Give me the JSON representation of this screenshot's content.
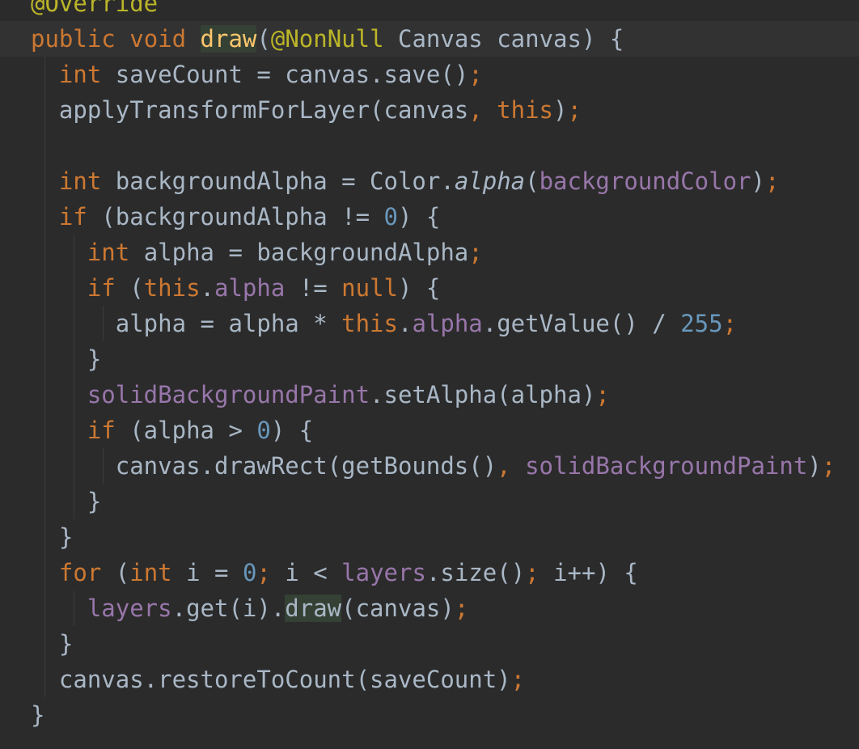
{
  "editor": {
    "colors": {
      "background": "#2b2b2b",
      "current_line": "#323232",
      "default_text": "#a9b7c6",
      "keyword": "#cc7832",
      "annotation": "#bbb529",
      "method_declaration": "#ffc66d",
      "field": "#9876aa",
      "number": "#6897bb",
      "usage_highlight": "#344134",
      "indent_guide": "#3b3b3b"
    },
    "lines": [
      {
        "indent": 0,
        "tokens": [
          {
            "t": "@Override",
            "c": "ann"
          }
        ]
      },
      {
        "indent": 0,
        "current": true,
        "tokens": [
          {
            "t": "public",
            "c": "kw"
          },
          {
            "t": " "
          },
          {
            "t": "void",
            "c": "kw"
          },
          {
            "t": " "
          },
          {
            "t": "draw",
            "c": "fn",
            "hl": true
          },
          {
            "t": "("
          },
          {
            "t": "@NonNull",
            "c": "ann"
          },
          {
            "t": " Canvas canvas) {"
          }
        ]
      },
      {
        "indent": 1,
        "tokens": [
          {
            "t": "int",
            "c": "kw"
          },
          {
            "t": " saveCount = canvas.save()"
          },
          {
            "t": ";",
            "c": "kw"
          }
        ]
      },
      {
        "indent": 1,
        "tokens": [
          {
            "t": "applyTransformForLayer(canvas"
          },
          {
            "t": ", ",
            "c": "kw"
          },
          {
            "t": "this",
            "c": "kw"
          },
          {
            "t": ")"
          },
          {
            "t": ";",
            "c": "kw"
          }
        ]
      },
      {
        "indent": 1,
        "tokens": []
      },
      {
        "indent": 1,
        "tokens": [
          {
            "t": "int",
            "c": "kw"
          },
          {
            "t": " backgroundAlpha = Color."
          },
          {
            "t": "alpha",
            "it": true
          },
          {
            "t": "("
          },
          {
            "t": "backgroundColor",
            "c": "fld"
          },
          {
            "t": ")"
          },
          {
            "t": ";",
            "c": "kw"
          }
        ]
      },
      {
        "indent": 1,
        "tokens": [
          {
            "t": "if",
            "c": "kw"
          },
          {
            "t": " (backgroundAlpha != "
          },
          {
            "t": "0",
            "c": "num"
          },
          {
            "t": ") {"
          }
        ]
      },
      {
        "indent": 2,
        "tokens": [
          {
            "t": "int",
            "c": "kw"
          },
          {
            "t": " alpha = backgroundAlpha"
          },
          {
            "t": ";",
            "c": "kw"
          }
        ]
      },
      {
        "indent": 2,
        "tokens": [
          {
            "t": "if",
            "c": "kw"
          },
          {
            "t": " ("
          },
          {
            "t": "this",
            "c": "kw"
          },
          {
            "t": "."
          },
          {
            "t": "alpha",
            "c": "fld"
          },
          {
            "t": " != "
          },
          {
            "t": "null",
            "c": "kw"
          },
          {
            "t": ") {"
          }
        ]
      },
      {
        "indent": 3,
        "tokens": [
          {
            "t": "alpha = alpha * "
          },
          {
            "t": "this",
            "c": "kw"
          },
          {
            "t": "."
          },
          {
            "t": "alpha",
            "c": "fld"
          },
          {
            "t": ".getValue() / "
          },
          {
            "t": "255",
            "c": "num"
          },
          {
            "t": ";",
            "c": "kw"
          }
        ]
      },
      {
        "indent": 2,
        "tokens": [
          {
            "t": "}"
          }
        ]
      },
      {
        "indent": 2,
        "tokens": [
          {
            "t": "solidBackgroundPaint",
            "c": "fld"
          },
          {
            "t": ".setAlpha(alpha)"
          },
          {
            "t": ";",
            "c": "kw"
          }
        ]
      },
      {
        "indent": 2,
        "tokens": [
          {
            "t": "if",
            "c": "kw"
          },
          {
            "t": " (alpha > "
          },
          {
            "t": "0",
            "c": "num"
          },
          {
            "t": ") {"
          }
        ]
      },
      {
        "indent": 3,
        "tokens": [
          {
            "t": "canvas.drawRect(getBounds()"
          },
          {
            "t": ", ",
            "c": "kw"
          },
          {
            "t": "solidBackgroundPaint",
            "c": "fld"
          },
          {
            "t": ")"
          },
          {
            "t": ";",
            "c": "kw"
          }
        ]
      },
      {
        "indent": 2,
        "tokens": [
          {
            "t": "}"
          }
        ]
      },
      {
        "indent": 1,
        "tokens": [
          {
            "t": "}"
          }
        ]
      },
      {
        "indent": 1,
        "tokens": [
          {
            "t": "for",
            "c": "kw"
          },
          {
            "t": " ("
          },
          {
            "t": "int",
            "c": "kw"
          },
          {
            "t": " i = "
          },
          {
            "t": "0",
            "c": "num"
          },
          {
            "t": "; ",
            "c": "kw"
          },
          {
            "t": "i < "
          },
          {
            "t": "layers",
            "c": "fld"
          },
          {
            "t": ".size()"
          },
          {
            "t": "; ",
            "c": "kw"
          },
          {
            "t": "i++) {"
          }
        ]
      },
      {
        "indent": 2,
        "tokens": [
          {
            "t": "layers",
            "c": "fld"
          },
          {
            "t": ".get(i)."
          },
          {
            "t": "draw",
            "hl": true
          },
          {
            "t": "(canvas)"
          },
          {
            "t": ";",
            "c": "kw"
          }
        ]
      },
      {
        "indent": 1,
        "tokens": [
          {
            "t": "}"
          }
        ]
      },
      {
        "indent": 1,
        "tokens": [
          {
            "t": "canvas.restoreToCount(saveCount)"
          },
          {
            "t": ";",
            "c": "kw"
          }
        ]
      },
      {
        "indent": 0,
        "tokens": [
          {
            "t": "}"
          }
        ]
      }
    ]
  }
}
